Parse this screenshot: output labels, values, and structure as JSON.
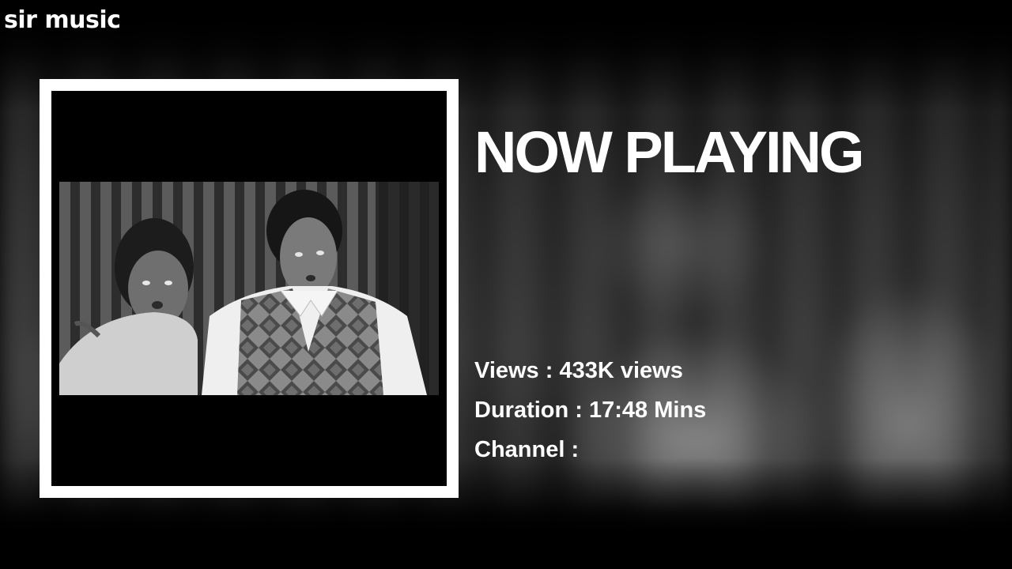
{
  "brand": {
    "name": "sir music"
  },
  "now_playing": {
    "heading": "NOW PLAYING",
    "thumbnail_icon": "video-thumbnail"
  },
  "meta": {
    "views_label": "Views :",
    "views_value": "433K views",
    "duration_label": "Duration :",
    "duration_value": "17:48 Mins",
    "channel_label": "Channel :",
    "channel_value": ""
  },
  "colors": {
    "background": "#000000",
    "text": "#ffffff",
    "frame": "#ffffff"
  }
}
